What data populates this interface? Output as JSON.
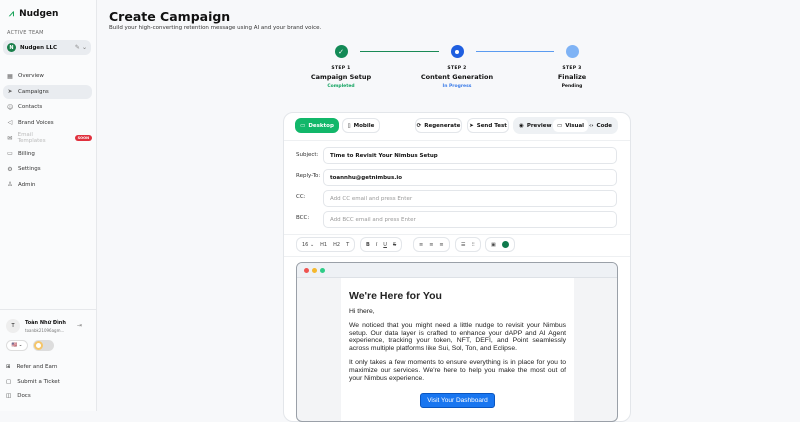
{
  "app": {
    "name": "Nudgen"
  },
  "sidebar": {
    "active_team_label": "ACTIVE TEAM",
    "team_name": "Nudgen LLC",
    "team_initial": "N",
    "items": [
      {
        "label": "Overview"
      },
      {
        "label": "Campaigns"
      },
      {
        "label": "Contacts"
      },
      {
        "label": "Brand Voices"
      },
      {
        "label": "Email Templates",
        "badge": "SOON"
      },
      {
        "label": "Billing"
      },
      {
        "label": "Settings"
      },
      {
        "label": "Admin"
      }
    ],
    "user": {
      "initial": "T",
      "name": "Toàn Nhữ Đình",
      "email": "toanbk21096agm..."
    },
    "flag": "🇺🇸 ⌄",
    "links": [
      {
        "label": "Refer and Earn"
      },
      {
        "label": "Submit a Ticket"
      },
      {
        "label": "Docs"
      }
    ]
  },
  "header": {
    "title": "Create Campaign",
    "subtitle": "Build your high-converting retention message using AI and your brand voice."
  },
  "steps": [
    {
      "num": "STEP 1",
      "title": "Campaign Setup",
      "status": "Completed"
    },
    {
      "num": "STEP 2",
      "title": "Content Generation",
      "status": "In Progress"
    },
    {
      "num": "STEP 3",
      "title": "Finalize",
      "status": "Pending"
    }
  ],
  "toolbar": {
    "desktop": "Desktop",
    "mobile": "Mobile",
    "regenerate": "Regenerate",
    "send_test": "Send Test",
    "preview": "Preview",
    "visual": "Visual",
    "code": "Code"
  },
  "fields": {
    "subject_label": "Subject:",
    "subject": "Time to Revisit Your Nimbus Setup",
    "reply_label": "Reply-To:",
    "reply": "toannhu@getnimbus.io",
    "cc_label": "CC:",
    "cc_placeholder": "Add CC email and press Enter",
    "bcc_label": "BCC:",
    "bcc_placeholder": "Add BCC email and press Enter"
  },
  "format": {
    "size": "16",
    "h1": "H1",
    "h2": "H2",
    "color": "#0f7a4d"
  },
  "email": {
    "heading": "We're Here for You",
    "greeting": "Hi there,",
    "p1": "We noticed that you might need a little nudge to revisit your Nimbus setup. Our data layer is crafted to enhance your dAPP and AI Agent experience, tracking your token, NFT, DEFI, and Point seamlessly across multiple platforms like Sui, Sol, Ton, and Eclipse.",
    "p2": "It only takes a few moments to ensure everything is in place for you to maximize our services. We're here to help you make the most out of your Nimbus experience.",
    "cta": "Visit Your Dashboard"
  },
  "colors": {
    "green": "#12b76a",
    "blue": "#2563eb"
  }
}
